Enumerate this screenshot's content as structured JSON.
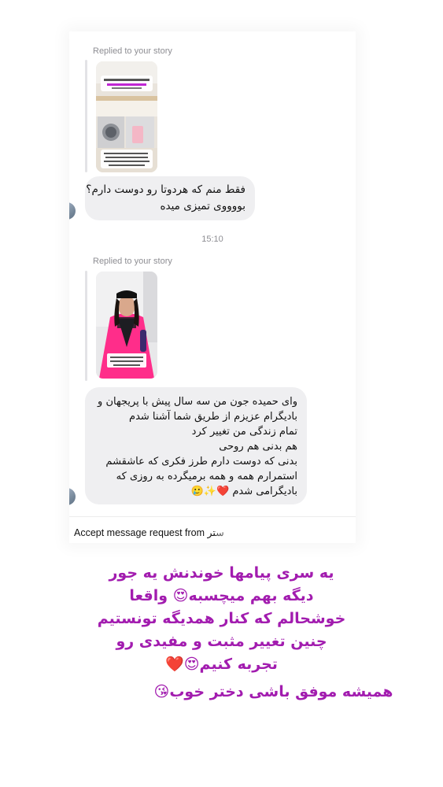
{
  "thread": {
    "story_reply_1": {
      "label": "Replied to your story",
      "thumb_icon": "story-thumbnail-laundry-room"
    },
    "message_1": {
      "lines": [
        "فقط منم که هردوتا رو دوست دارم؟",
        "بووووی تمیزی میده"
      ]
    },
    "timestamp": "15:10",
    "story_reply_2": {
      "label": "Replied to your story",
      "thumb_icon": "story-thumbnail-woman-in-pink"
    },
    "message_2": {
      "lines": [
        "وای حمیده جون من سه سال پیش با پریجهان و",
        "بادیگرام عزیزم از طریق شما آشنا شدم",
        "تمام زندگی من تغییر کرد",
        "هم بدنی هم روحی",
        "بدنی که دوست دارم طرز فکری که عاشقشم",
        "استمرارم همه و همه برمیگرده به روزی که",
        "بادیگرامی شدم"
      ],
      "emoji_tail": "❤️✨🥲"
    },
    "accept_request_label": "Accept message request from",
    "accept_request_partial": "ستر"
  },
  "caption": {
    "lines": [
      "یه سری پیامها خوندنش یه جور",
      "دیگه بهم میچسبه😍 واقعا",
      "خوشحالم که کنار همدیگه تونستیم",
      "چنین تغییر مثبت و مفیدی رو",
      "تجربه کنیم😍❤️"
    ],
    "closing": "همیشه موفق باشی دختر خوب😘",
    "color": "#a21caf"
  }
}
